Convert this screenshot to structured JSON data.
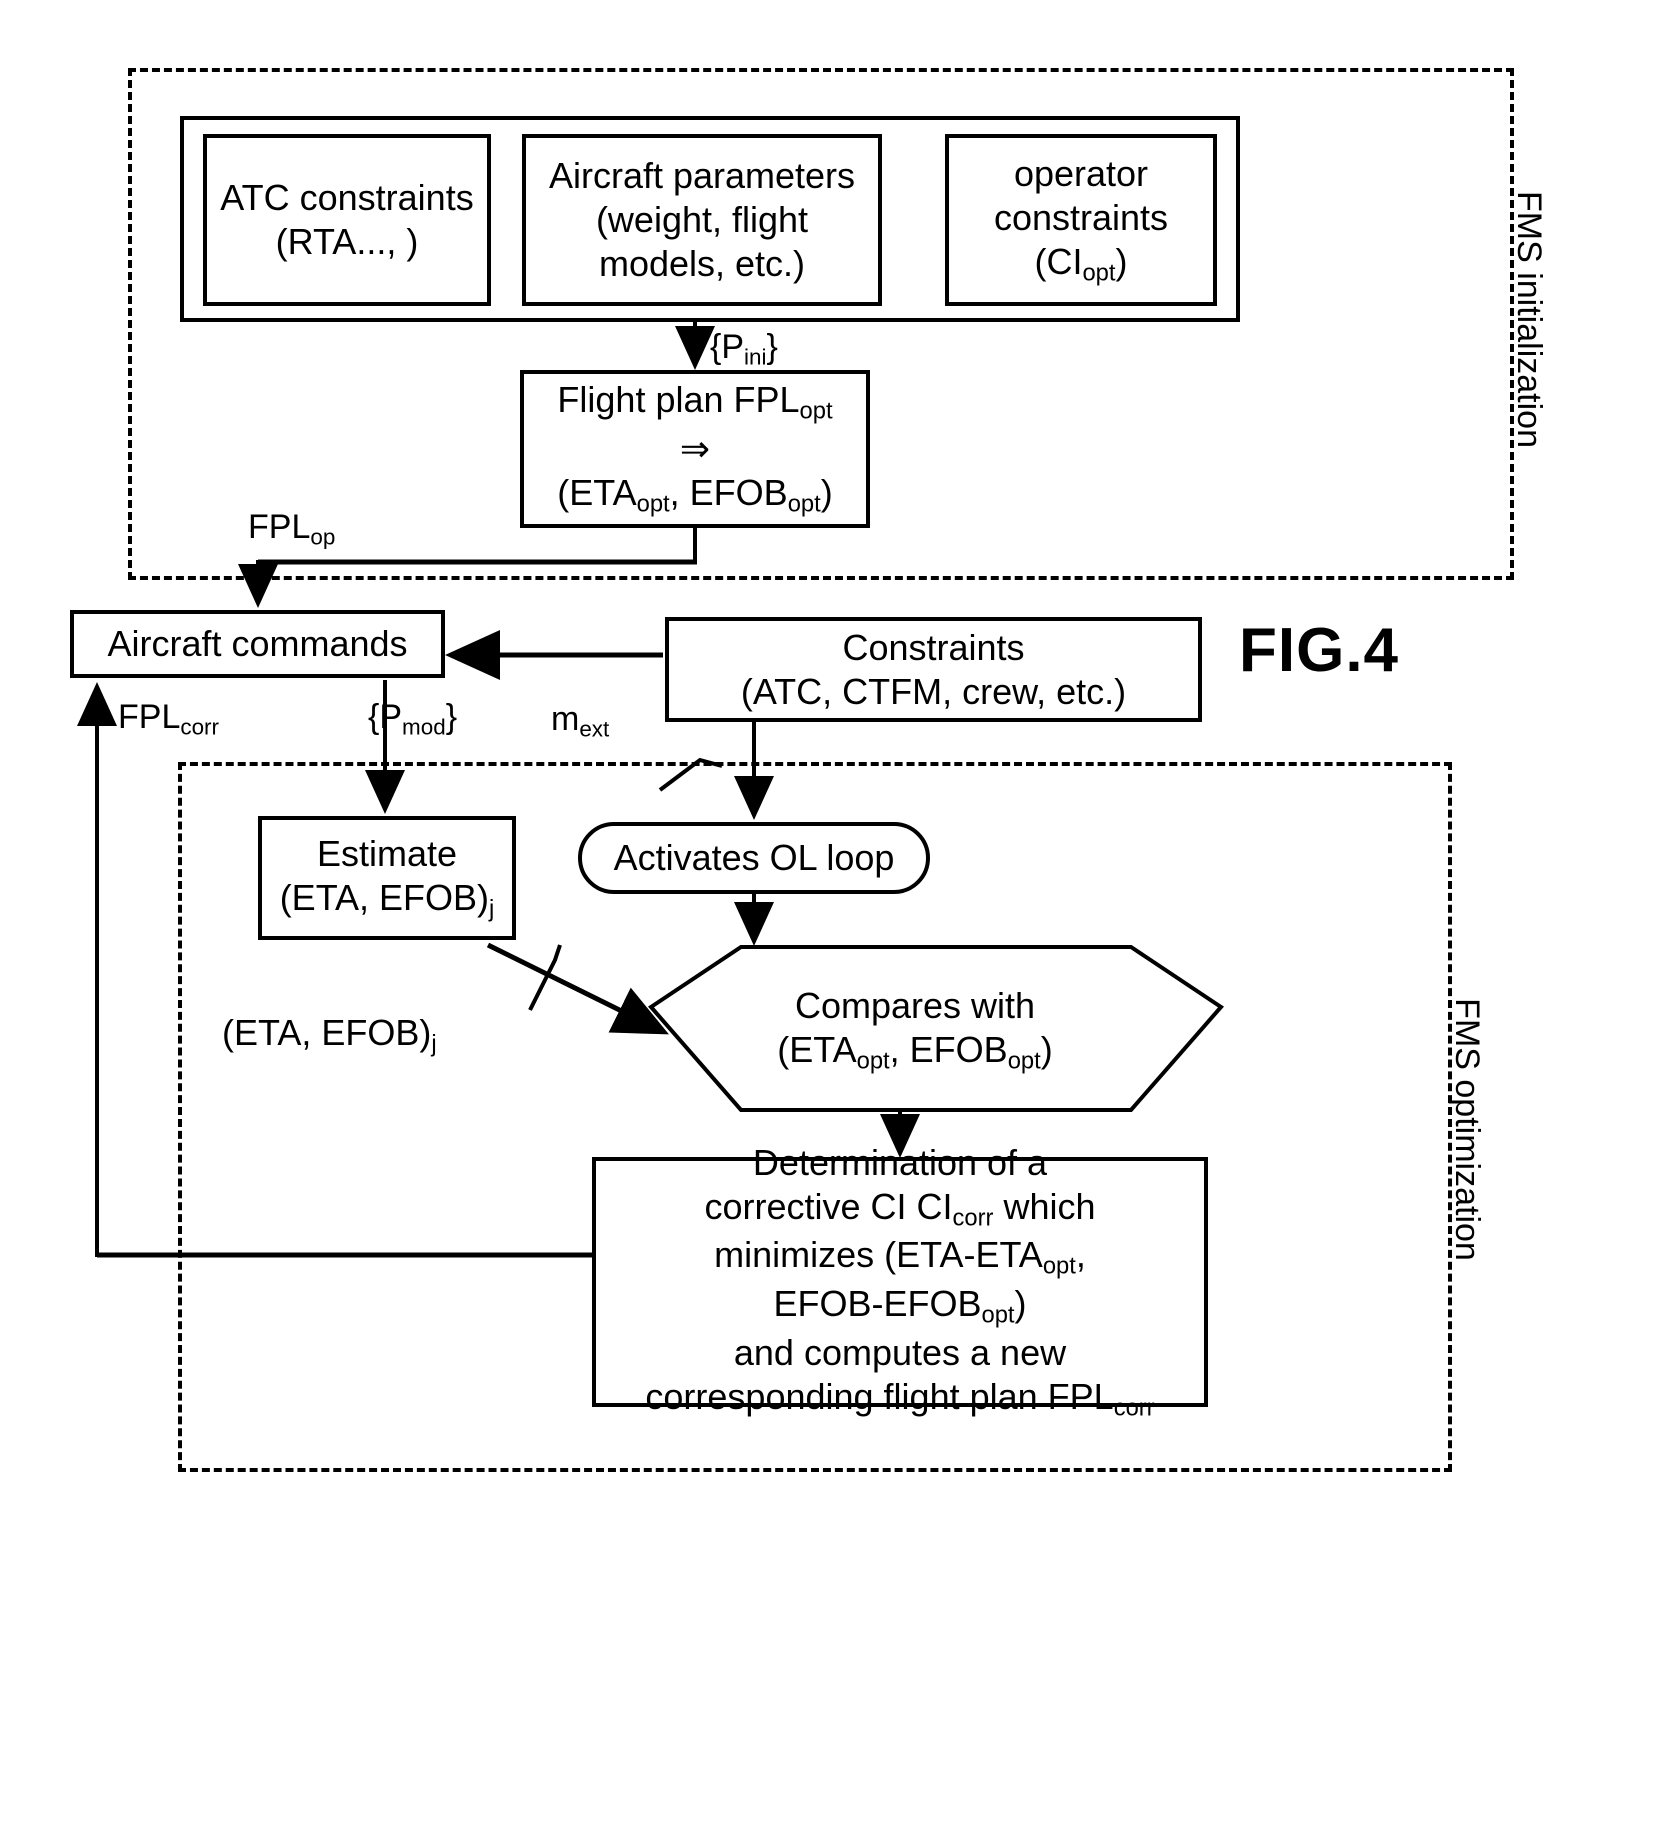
{
  "figure": {
    "label": "FIG.4"
  },
  "sections": {
    "initialization": {
      "label": "FMS initialization"
    },
    "optimization": {
      "label": "FMS optimization"
    }
  },
  "boxes": {
    "atc_constraints": {
      "line1": "ATC constraints",
      "line2": "(RTA..., )"
    },
    "aircraft_parameters": {
      "line1": "Aircraft parameters",
      "line2": "(weight, flight",
      "line3": "models, etc.)"
    },
    "operator_constraints": {
      "line1": "operator",
      "line2": "constraints",
      "line3_pre": "(CI",
      "line3_sub": "opt",
      "line3_post": ")"
    },
    "flight_plan": {
      "line1_pre": "Flight plan  FPL",
      "line1_sub": "opt",
      "line2": "⇒",
      "line3_pre": "(ETA",
      "line3_sub1": "opt",
      "line3_mid": ", EFOB",
      "line3_sub2": "opt",
      "line3_post": ")"
    },
    "aircraft_commands": {
      "label": "Aircraft commands"
    },
    "constraints": {
      "line1": "Constraints",
      "line2": "(ATC, CTFM, crew, etc.)"
    },
    "estimate": {
      "line1": "Estimate",
      "line2_pre": "(ETA, EFOB)",
      "line2_sub": "j"
    },
    "activates_ol_loop": {
      "label": "Activates OL loop"
    },
    "compares": {
      "line1": "Compares with",
      "line2_pre": "(ETA",
      "line2_sub1": "opt",
      "line2_mid": ", EFOB",
      "line2_sub2": "opt",
      "line2_post": ")"
    },
    "determination": {
      "line1": "Determination of a",
      "line2_pre": "corrective CI CI",
      "line2_sub": "corr",
      "line2_post": " which",
      "line3_pre": "minimizes (ETA-ETA",
      "line3_sub": "opt",
      "line3_post": ",",
      "line4_pre": "EFOB-EFOB",
      "line4_sub": "opt",
      "line4_post": ")",
      "line5": "and computes a new",
      "line6_pre": "corresponding flight plan FPL",
      "line6_sub": "corr"
    }
  },
  "edge_labels": {
    "p_ini": {
      "pre": "{P",
      "sub": "ini",
      "post": "}"
    },
    "fpl_op": {
      "pre": "FPL",
      "sub": "op"
    },
    "fpl_corr": {
      "pre": "FPL",
      "sub": "corr"
    },
    "p_mod": {
      "pre": "{P",
      "sub": "mod",
      "post": "}"
    },
    "m_ext": {
      "pre": "m",
      "sub": "ext"
    },
    "eta_efob_j": {
      "pre": "(ETA, EFOB)",
      "sub": "j"
    }
  },
  "colors": {
    "ink": "#000000",
    "paper": "#ffffff"
  }
}
